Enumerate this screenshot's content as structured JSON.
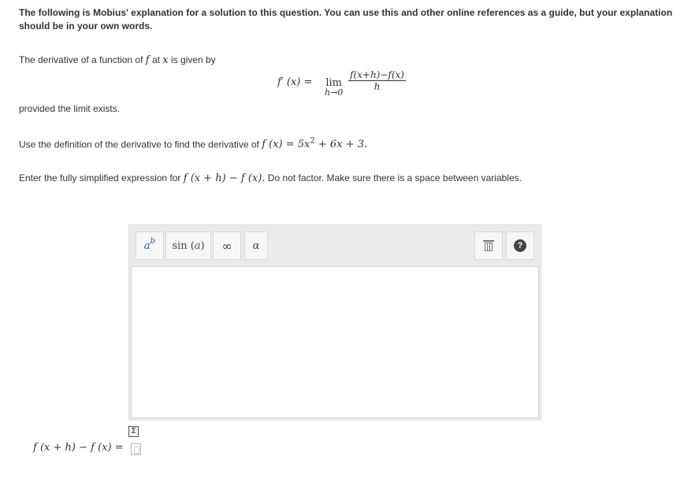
{
  "intro": {
    "text": "The following is Mobius' explanation for a solution to this question. You can use this and other online references as a guide, but your explanation should be in your own words."
  },
  "definition": {
    "prefix": "The derivative of a function of",
    "var_f": "f",
    "mid": "at",
    "var_x": "x",
    "suffix": "is given by"
  },
  "formula": {
    "lhs": "f′ (x) =",
    "lim": "lim",
    "lim_sub": "h→0",
    "numerator": "f(x+h)−f(x)",
    "denominator": "h"
  },
  "provided": "provided the limit exists.",
  "use_definition": {
    "text": "Use the definition of the derivative to find the derivative of",
    "math_lhs": "f (x) = 5x",
    "exponent": "2",
    "math_rest": "+ 6x + 3."
  },
  "instruction": {
    "prefix": "Enter the fully simplified expression for",
    "math": "f (x + h) − f (x).",
    "suffix": "Do not factor. Make sure there is a space between variables."
  },
  "editor": {
    "buttons": {
      "power_base": "a",
      "power_exp": "b",
      "func_name": "sin",
      "func_open": "(",
      "func_arg": "a",
      "func_close": ")",
      "infinity": "∞",
      "alpha": "α",
      "help": "?"
    },
    "input_value": ""
  },
  "answer": {
    "label": "f (x + h) − f (x) ="
  },
  "icons": {
    "sigma": "Σ"
  }
}
